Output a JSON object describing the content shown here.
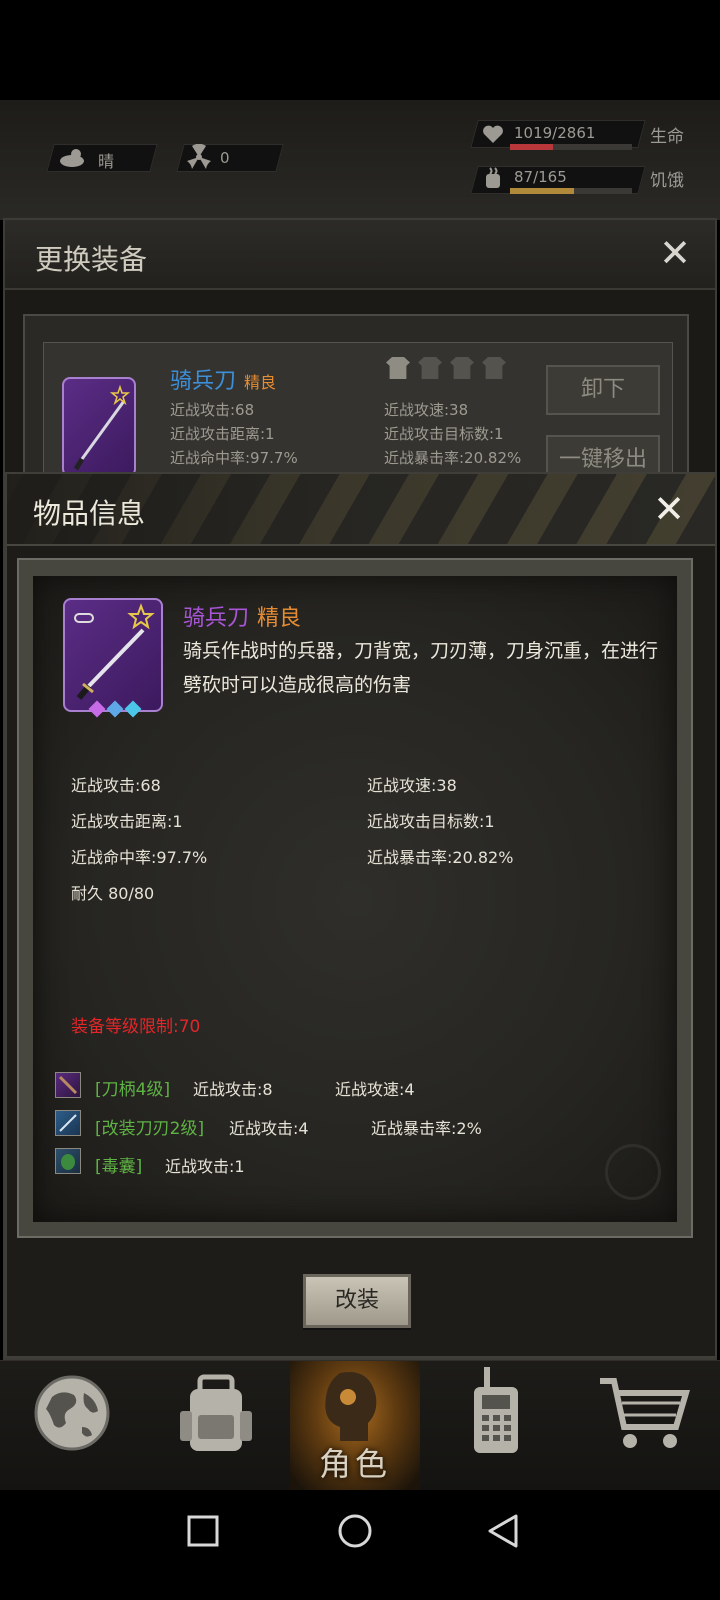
{
  "hud": {
    "weather": "晴",
    "radiation": "0",
    "health_value": "1019/2861",
    "health_label": "生命",
    "health_fraction": 0.356,
    "hunger_value": "87/165",
    "hunger_label": "饥饿",
    "hunger_fraction": 0.527
  },
  "equip_panel": {
    "title": "更换装备",
    "item_name": "骑兵刀",
    "item_quality": "精良",
    "stats": [
      "近战攻击:68",
      "近战攻速:38",
      "近战攻击距离:1",
      "近战攻击目标数:1",
      "近战命中率:97.7%",
      "近战暴击率:20.82%"
    ],
    "unequip_label": "卸下",
    "remove_all_label": "一键移出"
  },
  "item_info": {
    "title": "物品信息",
    "name": "骑兵刀",
    "quality": "精良",
    "description": "骑兵作战时的兵器，刀背宽，刀刃薄，刀身沉重，在进行劈砍时可以造成很高的伤害",
    "stats_left": [
      "近战攻击:68",
      "近战攻击距离:1",
      "近战命中率:97.7%",
      "耐久 80/80"
    ],
    "stats_right": [
      "近战攻速:38",
      "近战攻击目标数:1",
      "近战暴击率:20.82%"
    ],
    "requirement": "装备等级限制:70",
    "mods": [
      {
        "name": "[刀柄4级]",
        "stats": [
          "近战攻击:8",
          "近战攻速:4"
        ]
      },
      {
        "name": "[改装刀刃2级]",
        "stats": [
          "近战攻击:4",
          "近战暴击率:2%"
        ]
      },
      {
        "name": "[毒囊]",
        "stats": [
          "近战攻击:1"
        ]
      }
    ],
    "modify_button": "改装"
  },
  "bottom_nav": {
    "active_label": "角色",
    "items": [
      "map-icon",
      "backpack-icon",
      "character-icon",
      "radio-icon",
      "cart-icon"
    ]
  },
  "colors": {
    "quality_orange": "#e58b33",
    "name_purple": "#a855d6",
    "name_blue": "#3d8fd9",
    "mod_green": "#5fb244",
    "requirement_red": "#e2262a"
  }
}
